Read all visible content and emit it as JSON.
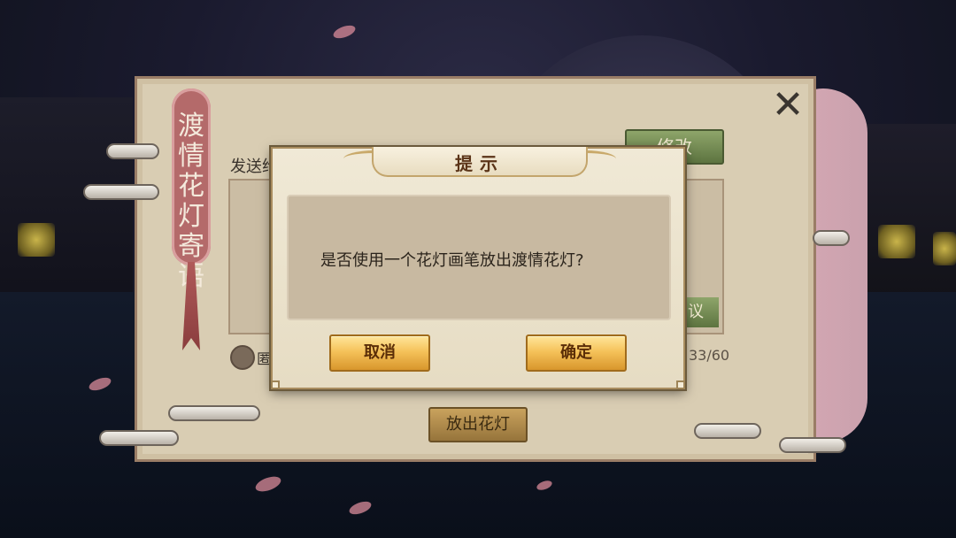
{
  "panel": {
    "banner_title": "渡情花灯寄语",
    "send_label": "发送给",
    "edit_button": "修改",
    "suggest_button": "议",
    "anon_label": "匿",
    "char_counter": "33/60",
    "release_button": "放出花灯",
    "close_icon": "✕"
  },
  "dialog": {
    "title": "提示",
    "message": "是否使用一个花灯画笔放出渡情花灯?",
    "cancel_button": "取消",
    "confirm_button": "确定"
  }
}
